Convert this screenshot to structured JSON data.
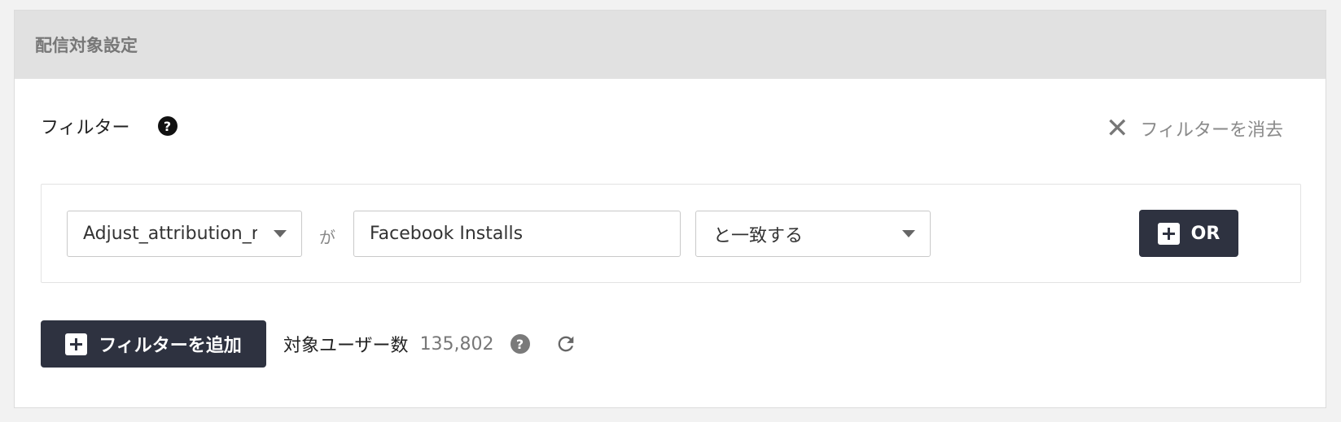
{
  "panel": {
    "title": "配信対象設定"
  },
  "filter": {
    "label": "フィルター",
    "help_icon": "question-circle-icon",
    "clear_label": "フィルターを消去",
    "clear_icon": "close-icon"
  },
  "condition": {
    "attribute": "Adjust_attribution_r",
    "connector": "が",
    "value": "Facebook Installs",
    "operator": "と一致する",
    "or_button_label": "OR"
  },
  "footer": {
    "add_filter_label": "フィルターを追加",
    "target_users_label": "対象ユーザー数",
    "target_users_count": "135,802",
    "help_icon": "question-circle-icon",
    "refresh_icon": "refresh-icon"
  },
  "colors": {
    "button_bg": "#2e3240",
    "header_bg": "#e1e1e1"
  }
}
